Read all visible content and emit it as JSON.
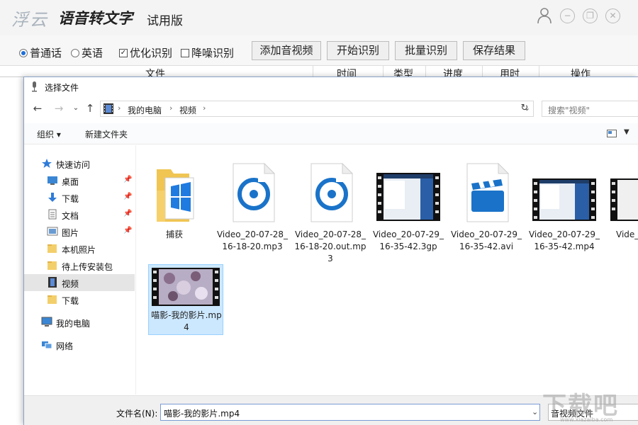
{
  "app": {
    "logo_text": "浮云",
    "title": "语音转文字",
    "edition": "试用版",
    "options": {
      "mandarin": "普通话",
      "english": "英语",
      "optimize": "优化识别",
      "denoise": "降噪识别"
    },
    "buttons": {
      "add_media": "添加音视频",
      "start": "开始识别",
      "batch": "批量识别",
      "save": "保存结果"
    },
    "columns": [
      "文件",
      "时间",
      "类型",
      "进度",
      "用时",
      "操作"
    ]
  },
  "dialog": {
    "title": "选择文件",
    "breadcrumbs": [
      "我的电脑",
      "视频"
    ],
    "search_placeholder": "搜索\"视频\"",
    "organize": "组织 ▾",
    "new_folder": "新建文件夹",
    "nav": {
      "quick_access": "快速访问",
      "desktop": "桌面",
      "downloads": "下载",
      "documents": "文档",
      "pictures": "图片",
      "photos": "本机照片",
      "pending": "待上传安装包",
      "videos": "视频",
      "downloads2": "下载",
      "this_pc": "我的电脑",
      "network": "网络"
    },
    "files": [
      {
        "name": "捕获",
        "kind": "folder-icon"
      },
      {
        "name": "Video_20-07-28_16-18-20.mp3",
        "kind": "audio-file-icon"
      },
      {
        "name": "Video_20-07-28_16-18-20.out.mp3",
        "kind": "audio-file-icon"
      },
      {
        "name": "Video_20-07-29_16-35-42.3gp",
        "kind": "video-thumbnail"
      },
      {
        "name": "Video_20-07-29_16-35-42.avi",
        "kind": "clapper-file-icon"
      },
      {
        "name": "Video_20-07-29_16-35-42.mp4",
        "kind": "video-thumbnail"
      },
      {
        "name": "Vide_16-",
        "kind": "video-thumbnail"
      },
      {
        "name": "喵影-我的影片.mp4",
        "kind": "video-thumbnail"
      }
    ],
    "filename_label": "文件名(N):",
    "filename_value": "喵影-我的影片.mp4",
    "filetype": "音视频文件"
  },
  "watermark": "下载吧",
  "watermark_url": "www.xiazaiba.com",
  "colors": {
    "accent": "#1e6fd9",
    "selection": "#cce8ff",
    "audio_icon": "#1a73c9"
  }
}
